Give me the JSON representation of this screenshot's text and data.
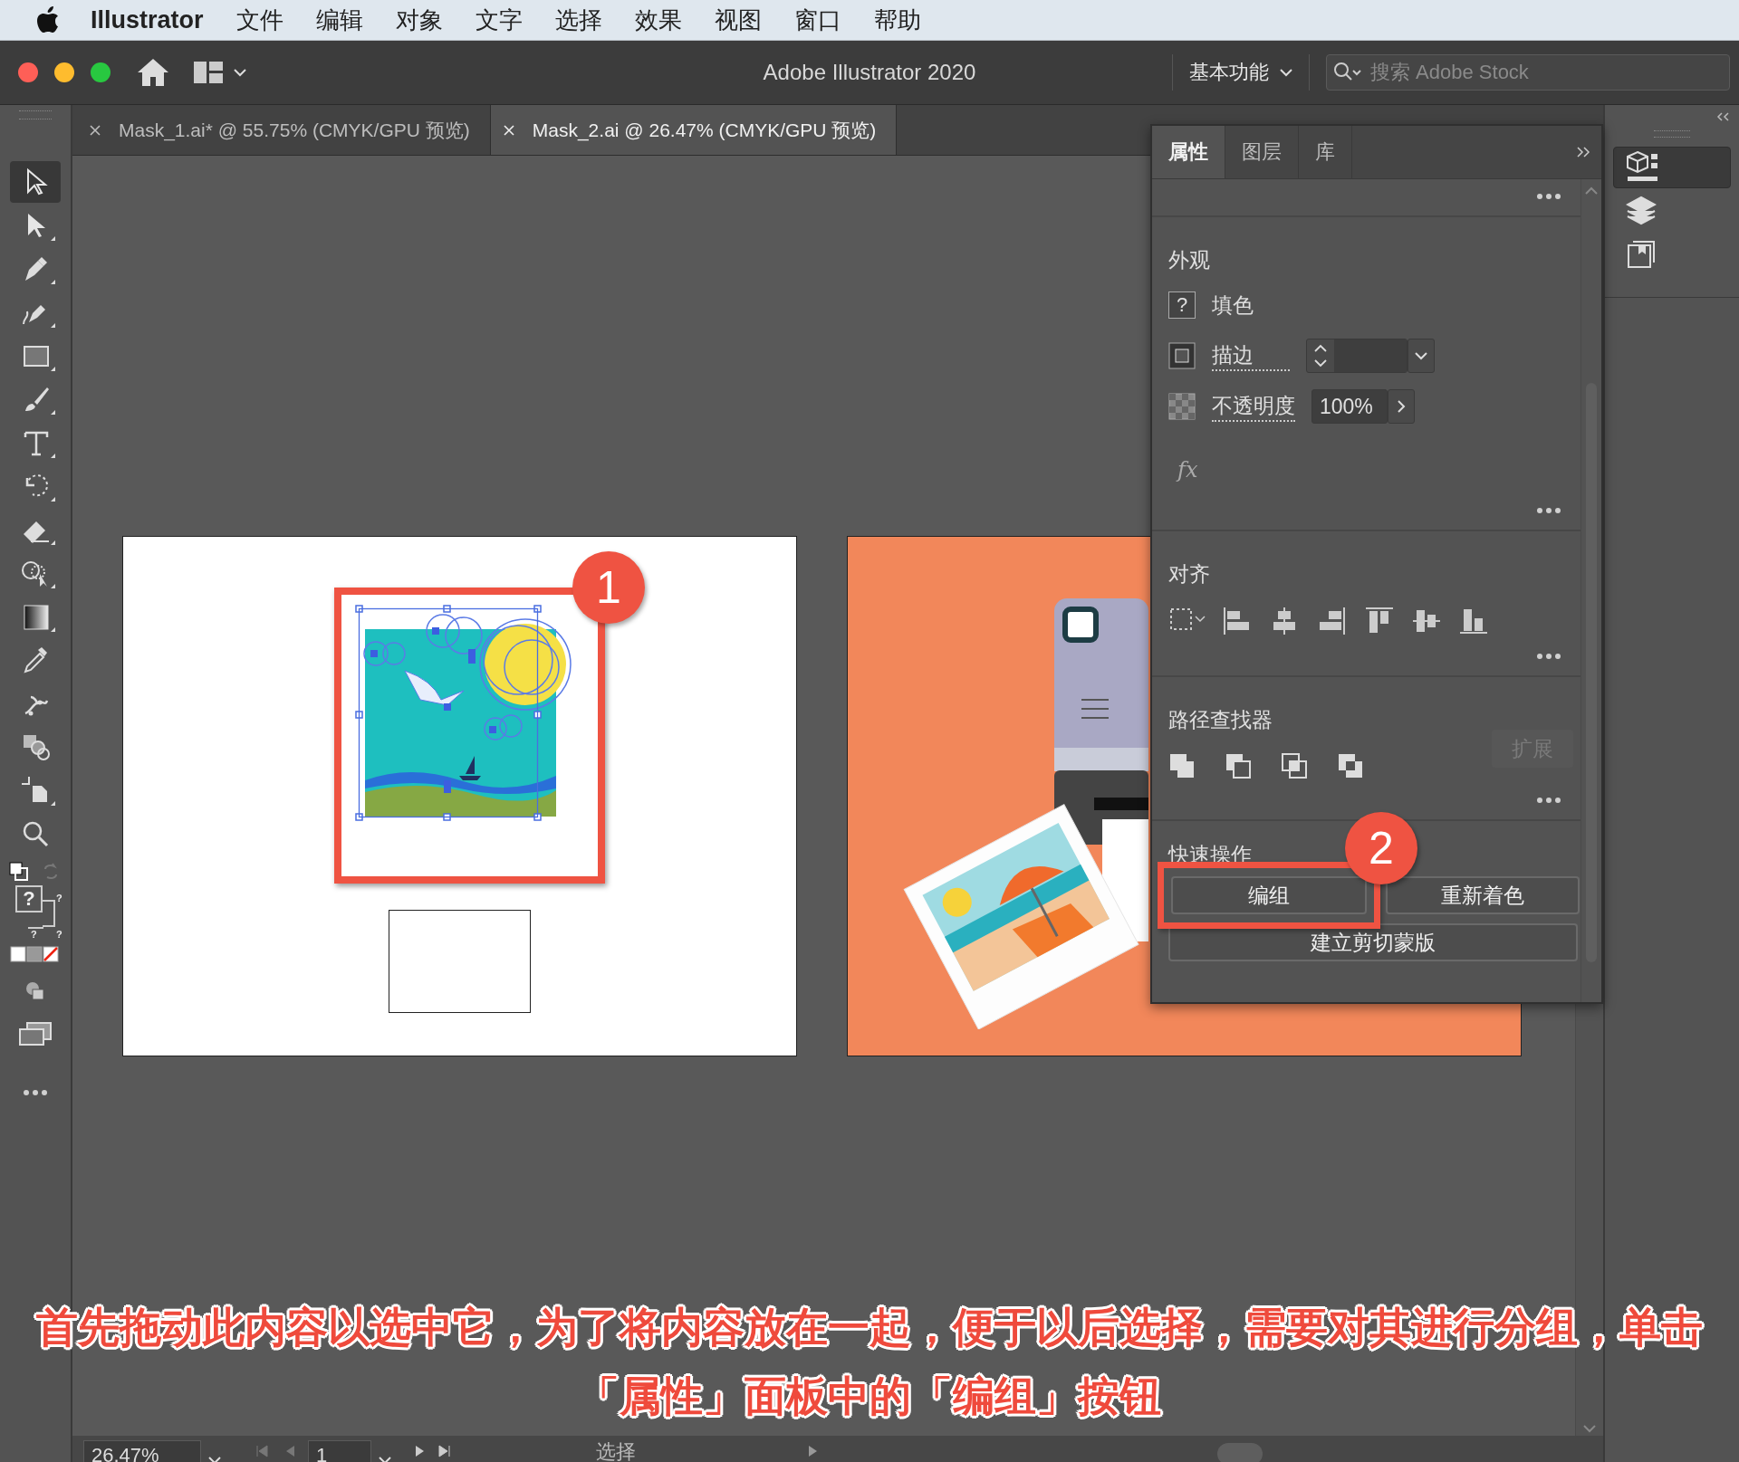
{
  "menubar": {
    "app": "Illustrator",
    "items": [
      "文件",
      "编辑",
      "对象",
      "文字",
      "选择",
      "效果",
      "视图",
      "窗口",
      "帮助"
    ]
  },
  "titlebar": {
    "title": "Adobe Illustrator 2020",
    "workspace": "基本功能",
    "search_placeholder": "搜索 Adobe Stock"
  },
  "document_tabs": [
    {
      "label": "Mask_1.ai* @ 55.75% (CMYK/GPU 预览)",
      "selected": false
    },
    {
      "label": "Mask_2.ai @ 26.47% (CMYK/GPU 预览)",
      "selected": true
    }
  ],
  "toolbar": {
    "tools": [
      {
        "kind": "selection",
        "selected": true
      },
      {
        "kind": "direct-selection",
        "selected": false
      },
      {
        "kind": "pen",
        "selected": false
      },
      {
        "kind": "curvature",
        "selected": false
      },
      {
        "kind": "rectangle",
        "selected": false
      },
      {
        "kind": "paintbrush",
        "selected": false
      },
      {
        "kind": "type",
        "selected": false
      },
      {
        "kind": "rotate",
        "selected": false
      },
      {
        "kind": "eraser",
        "selected": false
      },
      {
        "kind": "shape-builder",
        "selected": false
      },
      {
        "kind": "gradient",
        "selected": false
      },
      {
        "kind": "eyedropper",
        "selected": false
      },
      {
        "kind": "puppet-warp",
        "selected": false
      },
      {
        "kind": "shape-modes",
        "selected": false
      },
      {
        "kind": "artboard",
        "selected": false
      },
      {
        "kind": "zoom",
        "selected": false
      }
    ],
    "fill_marker": "?",
    "stroke_markers": [
      "?",
      "?",
      "?"
    ]
  },
  "artboards": [
    {
      "kind": "poster",
      "callout": "1"
    },
    {
      "kind": "camera"
    }
  ],
  "properties_panel": {
    "tabs": [
      {
        "label": "属性",
        "selected": true
      },
      {
        "label": "图层",
        "selected": false
      },
      {
        "label": "库",
        "selected": false
      }
    ],
    "appearance": {
      "title": "外观",
      "fill_swatch": "?",
      "fill_label": "填色",
      "stroke_label": "描边",
      "opacity_label": "不透明度",
      "opacity_value": "100%",
      "fx": "fx"
    },
    "align": {
      "title": "对齐"
    },
    "pathfinder": {
      "title": "路径查找器",
      "expand_button": {
        "label": "扩展",
        "disabled": true
      }
    },
    "quick_actions": {
      "title": "快速操作",
      "buttons": [
        {
          "label": "编组",
          "highlighted": true,
          "callout": "2"
        },
        {
          "label": "重新着色",
          "highlighted": false
        },
        {
          "label": "建立剪切蒙版",
          "highlighted": false
        }
      ]
    }
  },
  "caption": "首先拖动此内容以选中它，为了将内容放在一起，便于以后选择，需要对其进行分组，单击「属性」面板中的「编组」按钮",
  "status_bar": {
    "zoom": "26.47%",
    "artboard": "1",
    "tool": "选择"
  }
}
